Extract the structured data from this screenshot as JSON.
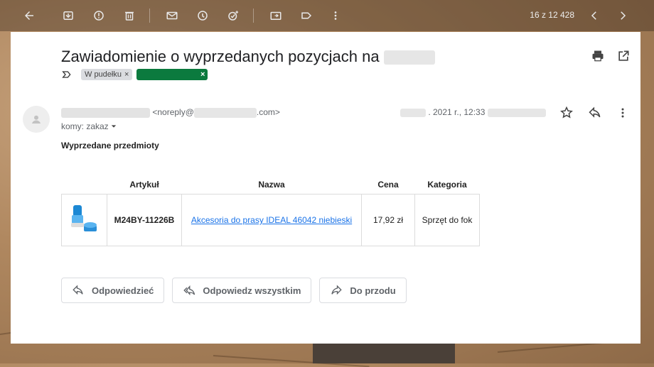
{
  "toolbar": {
    "counter": "16 z 12 428"
  },
  "email": {
    "subject": "Zawiadomienie o wyprzedanych pozycjach na",
    "label_inbox": "W pudełku",
    "label_remove": "×",
    "label_green_close": "×",
    "from_email_prefix": "<noreply@",
    "from_email_suffix": ".com>",
    "to_label": "komy: zakaz",
    "date": ". 2021 r., 12:33",
    "intro": "Wyprzedane przedmioty"
  },
  "table": {
    "headers": [
      "Artykuł",
      "Nazwa",
      "Cena",
      "Kategoria"
    ],
    "rows": [
      {
        "sku": "M24BY-11226B",
        "name": "Akcesoria do prasy IDEAL 46042 niebieski",
        "price": "17,92 zł",
        "category": "Sprzęt do fok"
      }
    ]
  },
  "actions": {
    "reply": "Odpowiedzieć",
    "reply_all": "Odpowiedz wszystkim",
    "forward": "Do przodu"
  },
  "colors": {
    "label_green": "#0b7a3e",
    "link": "#1a73e8"
  }
}
